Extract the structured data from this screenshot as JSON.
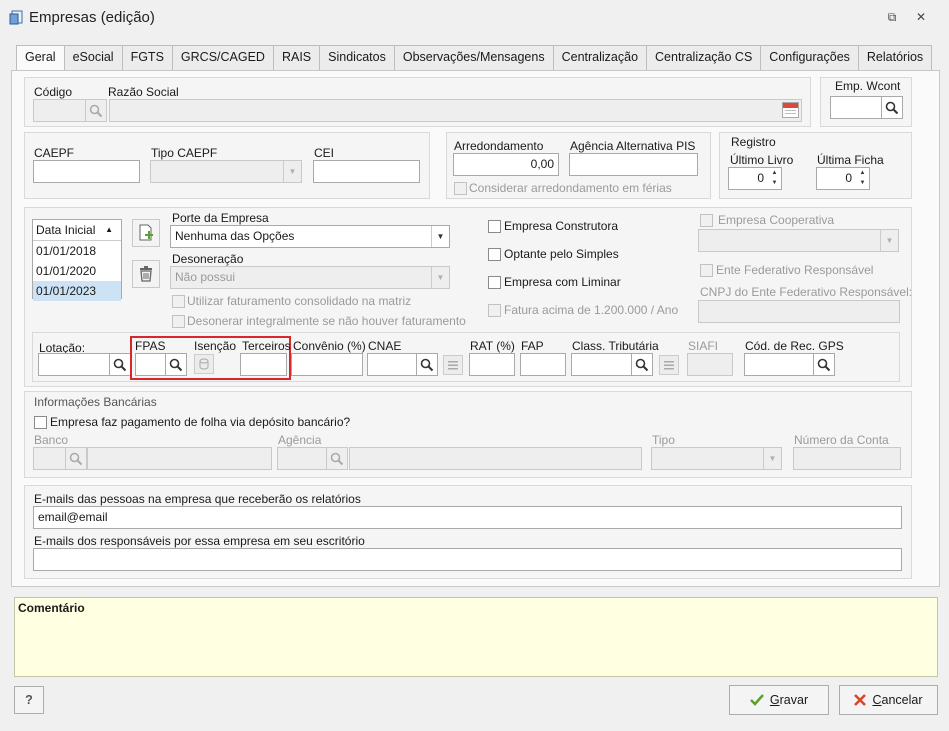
{
  "window": {
    "title": "Empresas (edição)"
  },
  "tabs": [
    "Geral",
    "eSocial",
    "FGTS",
    "GRCS/CAGED",
    "RAIS",
    "Sindicatos",
    "Observações/Mensagens",
    "Centralização",
    "Centralização CS",
    "Configurações",
    "Relatórios"
  ],
  "active_tab": "Geral",
  "identificacao": {
    "codigo_label": "Código",
    "codigo_value": "",
    "razao_label": "Razão Social",
    "razao_value": "",
    "emp_wcont_label": "Emp. Wcont",
    "emp_wcont_value": ""
  },
  "caepf": {
    "caepf_label": "CAEPF",
    "tipo_label": "Tipo CAEPF",
    "cei_label": "CEI"
  },
  "arredondamento": {
    "label": "Arredondamento",
    "value": "0,00",
    "agencia_label": "Agência Alternativa PIS",
    "ferias_label": "Considerar arredondamento em férias"
  },
  "registro": {
    "title": "Registro",
    "livro_label": "Último Livro",
    "livro_value": "0",
    "ficha_label": "Última Ficha",
    "ficha_value": "0"
  },
  "datas": {
    "header": "Data Inicial",
    "rows": [
      "01/01/2018",
      "01/01/2020",
      "01/01/2023"
    ]
  },
  "porte": {
    "label": "Porte da Empresa",
    "value": "Nenhuma das Opções"
  },
  "desoneracao": {
    "label": "Desoneração",
    "value": "Não possui"
  },
  "options": {
    "faturamento": "Utilizar faturamento consolidado na matriz",
    "desonerar": "Desonerar integralmente se não houver faturamento",
    "construtora": "Empresa Construtora",
    "simples": "Optante pelo Simples",
    "liminar": "Empresa com Liminar",
    "fatura": "Fatura acima de 1.200.000 / Ano",
    "cooperativa": "Empresa Cooperativa",
    "ente": "Ente Federativo Responsável",
    "cnpj_ente": "CNPJ do Ente Federativo Responsável:"
  },
  "lotacao": {
    "lotacao": "Lotação:",
    "fpas": "FPAS",
    "isencao": "Isenção",
    "terceiros": "Terceiros",
    "convenio": "Convênio (%)",
    "cnae": "CNAE",
    "rat": "RAT (%)",
    "fap": "FAP",
    "class_trib": "Class. Tributária",
    "siafi": "SIAFI",
    "cod_gps": "Cód. de Rec. GPS"
  },
  "bancarias": {
    "title": "Informações Bancárias",
    "deposito": "Empresa faz pagamento de folha via depósito bancário?",
    "banco": "Banco",
    "agencia": "Agência",
    "tipo": "Tipo",
    "conta": "Número da Conta"
  },
  "emails": {
    "empresa_label": "E-mails das pessoas na empresa que receberão os relatórios",
    "empresa_value": "email@email",
    "escritorio_label": "E-mails dos responsáveis por essa empresa em seu escritório",
    "escritorio_value": ""
  },
  "comentario": {
    "label": "Comentário"
  },
  "buttons": {
    "help": "?",
    "gravar_u": "G",
    "gravar_rest": "ravar",
    "cancelar_u": "C",
    "cancelar_rest": "ancelar"
  },
  "colors": {
    "highlight": "#d9262a",
    "comment_bg": "#ffffe1",
    "selected_row": "#cde3f5"
  }
}
